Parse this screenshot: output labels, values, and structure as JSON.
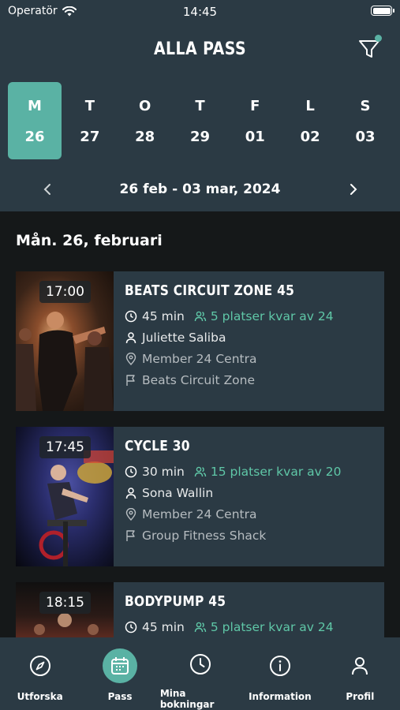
{
  "status": {
    "carrier": "Operatör",
    "time": "14:45"
  },
  "header": {
    "title": "ALLA PASS",
    "filter_icon": "filter-icon",
    "filter_active": true
  },
  "calendar": {
    "days": [
      {
        "weekday": "M",
        "date": "26",
        "selected": true
      },
      {
        "weekday": "T",
        "date": "27",
        "selected": false
      },
      {
        "weekday": "O",
        "date": "28",
        "selected": false
      },
      {
        "weekday": "T",
        "date": "29",
        "selected": false
      },
      {
        "weekday": "F",
        "date": "01",
        "selected": false
      },
      {
        "weekday": "L",
        "date": "02",
        "selected": false
      },
      {
        "weekday": "S",
        "date": "03",
        "selected": false
      }
    ],
    "range": "26 feb - 03 mar, 2024"
  },
  "section": {
    "date": "Mån. 26, februari"
  },
  "classes": [
    {
      "time": "17:00",
      "name": "BEATS CIRCUIT ZONE 45",
      "duration": "45 min",
      "spots": "5 platser kvar av 24",
      "instructor": "Juliette Saliba",
      "location": "Member 24 Centra",
      "room": "Beats Circuit Zone"
    },
    {
      "time": "17:45",
      "name": "CYCLE 30",
      "duration": "30 min",
      "spots": "15 platser kvar av 20",
      "instructor": "Sona Wallin",
      "location": "Member 24 Centra",
      "room": "Group Fitness Shack"
    },
    {
      "time": "18:15",
      "name": "BODYPUMP 45",
      "duration": "45 min",
      "spots": "5 platser kvar av 24",
      "instructor": "",
      "location": "",
      "room": ""
    }
  ],
  "tabbar": {
    "items": [
      {
        "label": "Utforska",
        "icon": "compass-icon"
      },
      {
        "label": "Pass",
        "icon": "calendar-icon"
      },
      {
        "label": "Mina bokningar",
        "icon": "clock-icon"
      },
      {
        "label": "Information",
        "icon": "info-icon"
      },
      {
        "label": "Profil",
        "icon": "person-icon"
      }
    ],
    "active": "Pass"
  },
  "colors": {
    "accent": "#5ab2a4",
    "panel": "#2b3a44",
    "background": "#151819",
    "spots_green": "#5fc7a7"
  }
}
